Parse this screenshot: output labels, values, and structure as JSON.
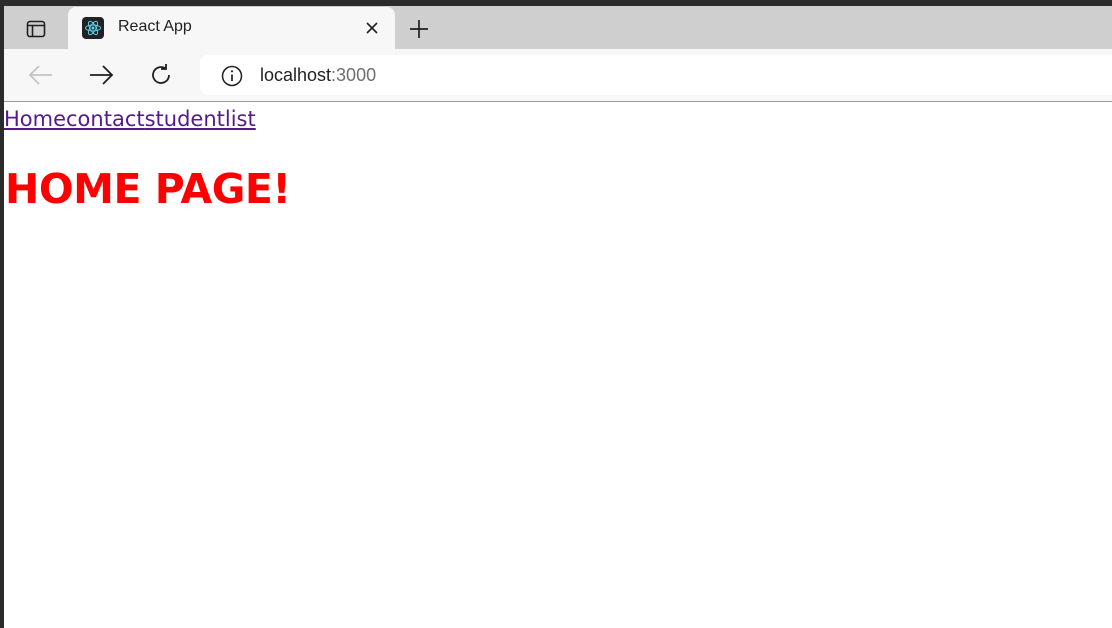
{
  "browser": {
    "tab": {
      "title": "React App",
      "favicon": "react-logo-icon"
    },
    "icons": {
      "tab_actions": "tab-actions-icon",
      "close_tab": "close-icon",
      "new_tab": "plus-icon",
      "back": "arrow-left-icon",
      "forward": "arrow-right-icon",
      "reload": "reload-icon",
      "site_info": "info-icon"
    },
    "address": {
      "host": "localhost",
      "port": ":3000"
    },
    "colors": {
      "tab_strip": "#cfcfcf",
      "toolbar": "#f7f7f7",
      "favicon_bg": "#222222",
      "react_blue": "#61dafb"
    }
  },
  "page": {
    "nav_links": [
      {
        "label": "Home"
      },
      {
        "label": "contact"
      },
      {
        "label": "studentlist"
      }
    ],
    "heading": "HOME PAGE!",
    "colors": {
      "link": "#551a8b",
      "heading": "#ff0000"
    }
  }
}
